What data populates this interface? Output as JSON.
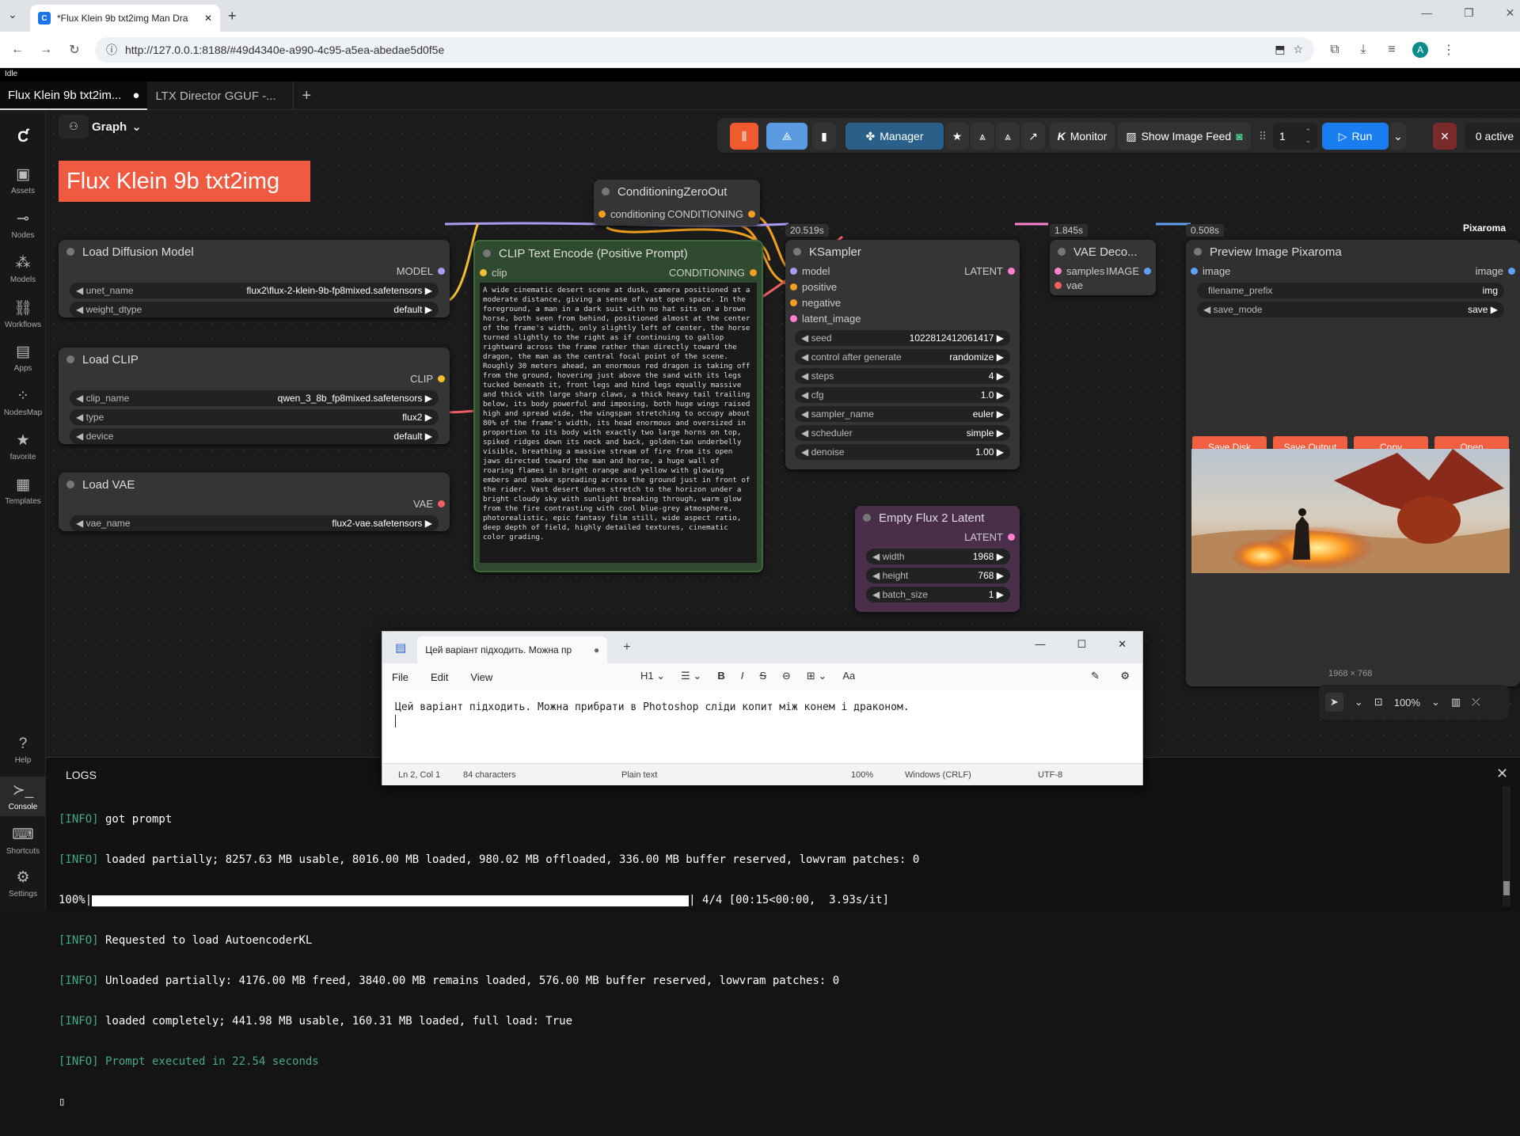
{
  "browser": {
    "tab_title": "*Flux Klein 9b txt2img Man Dra",
    "url": "http://127.0.0.1:8188/#49d4340e-a990-4c95-a5ea-abedae5d0f5e",
    "profile": "A"
  },
  "app": {
    "status": "Idle",
    "tabs": [
      "Flux Klein 9b txt2im...",
      "LTX Director GGUF -..."
    ],
    "graph_label": "Graph",
    "title_banner": "Flux Klein 9b txt2img",
    "sidebar": [
      "Assets",
      "Nodes",
      "Models",
      "Workflows",
      "Apps",
      "NodesMap",
      "favorite",
      "Templates",
      "Help",
      "Console",
      "Shortcuts",
      "Settings"
    ],
    "toolbar": {
      "manager": "Manager",
      "monitor": "Monitor",
      "image_feed": "Show Image Feed",
      "batch": "1",
      "run": "Run",
      "active": "0 active"
    },
    "zoom": "100%",
    "pixaroma_badge": "Pixaroma"
  },
  "nodes": {
    "cond_zero": {
      "title": "ConditioningZeroOut",
      "in": "conditioning",
      "out": "CONDITIONING"
    },
    "diffusion": {
      "title": "Load Diffusion Model",
      "out": "MODEL",
      "w1": "unet_name",
      "v1": "flux2\\flux-2-klein-9b-fp8mixed.safetensors",
      "w2": "weight_dtype",
      "v2": "default"
    },
    "clip": {
      "title": "Load CLIP",
      "out": "CLIP",
      "w1": "clip_name",
      "v1": "qwen_3_8b_fp8mixed.safetensors",
      "w2": "type",
      "v2": "flux2",
      "w3": "device",
      "v3": "default"
    },
    "vae": {
      "title": "Load VAE",
      "out": "VAE",
      "w1": "vae_name",
      "v1": "flux2-vae.safetensors"
    },
    "clip_text": {
      "title": "CLIP Text Encode (Positive Prompt)",
      "in": "clip",
      "out": "CONDITIONING",
      "prompt": "A wide cinematic desert scene at dusk, camera positioned at a moderate distance, giving a sense of vast open space. In the foreground, a man in a dark suit with no hat sits on a brown horse, both seen from behind, positioned almost at the center of the frame's width, only slightly left of center, the horse turned slightly to the right as if continuing to gallop rightward across the frame rather than directly toward the dragon, the man as the central focal point of the scene. Roughly 30 meters ahead, an enormous red dragon is taking off from the ground, hovering just above the sand with its legs tucked beneath it, front legs and hind legs equally massive and thick with large sharp claws, a thick heavy tail trailing below, its body powerful and imposing, both huge wings raised high and spread wide, the wingspan stretching to occupy about 80% of the frame's width, its head enormous and oversized in proportion to its body with exactly two large horns on top, spiked ridges down its neck and back, golden-tan underbelly visible, breathing a massive stream of fire from its open jaws directed toward the man and horse, a huge wall of roaring flames in bright orange and yellow with glowing embers and smoke spreading across the ground just in front of the rider. Vast desert dunes stretch to the horizon under a bright cloudy sky with sunlight breaking through, warm glow from the fire contrasting with cool blue-grey atmosphere, photorealistic, epic fantasy film still, wide aspect ratio, deep depth of field, highly detailed textures, cinematic color grading."
    },
    "ksampler": {
      "time": "20.519s",
      "title": "KSampler",
      "in1": "model",
      "in2": "positive",
      "in3": "negative",
      "in4": "latent_image",
      "out": "LATENT",
      "widgets": [
        [
          "seed",
          "1022812412061417"
        ],
        [
          "control after generate",
          "randomize"
        ],
        [
          "steps",
          "4"
        ],
        [
          "cfg",
          "1.0"
        ],
        [
          "sampler_name",
          "euler"
        ],
        [
          "scheduler",
          "simple"
        ],
        [
          "denoise",
          "1.00"
        ]
      ]
    },
    "vae_decode": {
      "time": "1.845s",
      "title": "VAE Deco...",
      "in1": "samples",
      "in2": "vae",
      "out": "IMAGE"
    },
    "preview": {
      "time": "0.508s",
      "title": "Preview Image Pixaroma",
      "in": "image",
      "out": "image",
      "w1": "filename_prefix",
      "v1": "img",
      "w2": "save_mode",
      "v2": "save",
      "buttons": [
        "Save Disk",
        "Save Output",
        "Copy",
        "Open"
      ],
      "dims": "1968 × 768"
    },
    "latent": {
      "title": "Empty Flux 2 Latent",
      "out": "LATENT",
      "widgets": [
        [
          "width",
          "1968"
        ],
        [
          "height",
          "768"
        ],
        [
          "batch_size",
          "1"
        ]
      ]
    }
  },
  "notepad": {
    "tab": "Цей варіант підходить. Можна пр",
    "menu": [
      "File",
      "Edit",
      "View"
    ],
    "heading": "H1",
    "text": "Цей варіант підходить. Можна прибрати в Photoshop сліди копит між конем і драконом.",
    "status": [
      "Ln 2, Col 1",
      "84 characters",
      "Plain text",
      "100%",
      "Windows (CRLF)",
      "UTF-8"
    ]
  },
  "logs": {
    "title": "LOGS",
    "lines": [
      [
        "[INFO]",
        " got prompt"
      ],
      [
        "[INFO]",
        " loaded partially; 8257.63 MB usable, 8016.00 MB loaded, 980.02 MB offloaded, 336.00 MB buffer reserved, lowvram patches: 0"
      ],
      [
        "",
        "100%|"
      ],
      [
        "[INFO]",
        " Requested to load AutoencoderKL"
      ],
      [
        "[INFO]",
        " Unloaded partially: 4176.00 MB freed, 3840.00 MB remains loaded, 576.00 MB buffer reserved, lowvram patches: 0"
      ],
      [
        "[INFO]",
        " loaded completely; 441.98 MB usable, 160.31 MB loaded, full load: True"
      ],
      [
        "[INFO]",
        " Prompt executed in 22.54 seconds"
      ]
    ],
    "progress_tail": "| 4/4 [00:15<00:00,  3.93s/it]",
    "progress": 1.0
  }
}
